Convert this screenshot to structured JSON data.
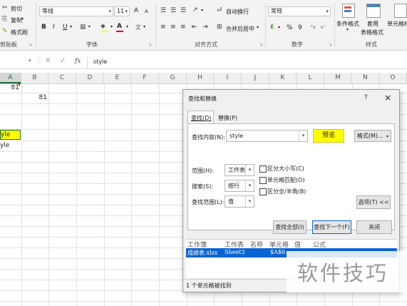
{
  "ribbon": {
    "clipboard": {
      "cut": "剪切",
      "copy": "复制",
      "format_painter": "格式刷",
      "group_label": "剪贴板"
    },
    "font": {
      "font_name": "等线",
      "font_size": "11",
      "grow": "A",
      "shrink": "A",
      "bold": "B",
      "italic": "I",
      "underline": "U",
      "wen": "文",
      "group_label": "字体"
    },
    "alignment": {
      "wrap_text": "自动换行",
      "merge_center": "合并后居中",
      "group_label": "对齐方式"
    },
    "number": {
      "format": "常规",
      "percent": "%",
      "comma": "9",
      "group_label": "数字"
    },
    "styles": {
      "conditional": "条件格式",
      "table_format_1": "套用",
      "table_format_2": "表格格式",
      "cell_styles": "单元格样",
      "group_label": "样式"
    }
  },
  "formula_bar": {
    "name_box": "",
    "fx": "fx",
    "value": "style"
  },
  "grid": {
    "columns": [
      "A",
      "B",
      "C",
      "D",
      "E",
      "F",
      "G",
      "H",
      "I",
      "J",
      "K",
      "L",
      "M",
      "N",
      "O"
    ],
    "a1_value": "81",
    "b2_value": "81",
    "a5_value": "yle",
    "a6_value": "yle"
  },
  "dialog": {
    "title": "查找和替换",
    "help": "?",
    "close": "×",
    "tab_find": "查找(D)",
    "tab_replace": "替换(P)",
    "find_label": "查找内容(N):",
    "find_value": "style",
    "preview": "预览",
    "format_btn": "格式(M)...",
    "within_label": "范围(H):",
    "within_value": "工作表",
    "search_label": "搜索(S):",
    "search_value": "按行",
    "lookin_label": "查找范围(L):",
    "lookin_value": "值",
    "match_case": "区分大小写(C)",
    "match_entire": "单元格匹配(O)",
    "match_width": "区分全/半角(B)",
    "options_btn": "选项(T) <<",
    "find_all": "查找全部(I)",
    "find_next": "查找下一个(F)",
    "close_btn": "关闭",
    "results": {
      "headers": [
        "工作簿",
        "工作表",
        "名称",
        "单元格",
        "值",
        "公式"
      ],
      "row": [
        "成绩表.xlsx",
        "Sheet3",
        "",
        "$A$6"
      ]
    },
    "status": "1 个单元格被找到"
  },
  "watermark": "软件技巧",
  "colors": {
    "preview_bg": "#ffff00",
    "selection_blue": "#0a64d2",
    "cell_yellow": "#ffff00"
  }
}
